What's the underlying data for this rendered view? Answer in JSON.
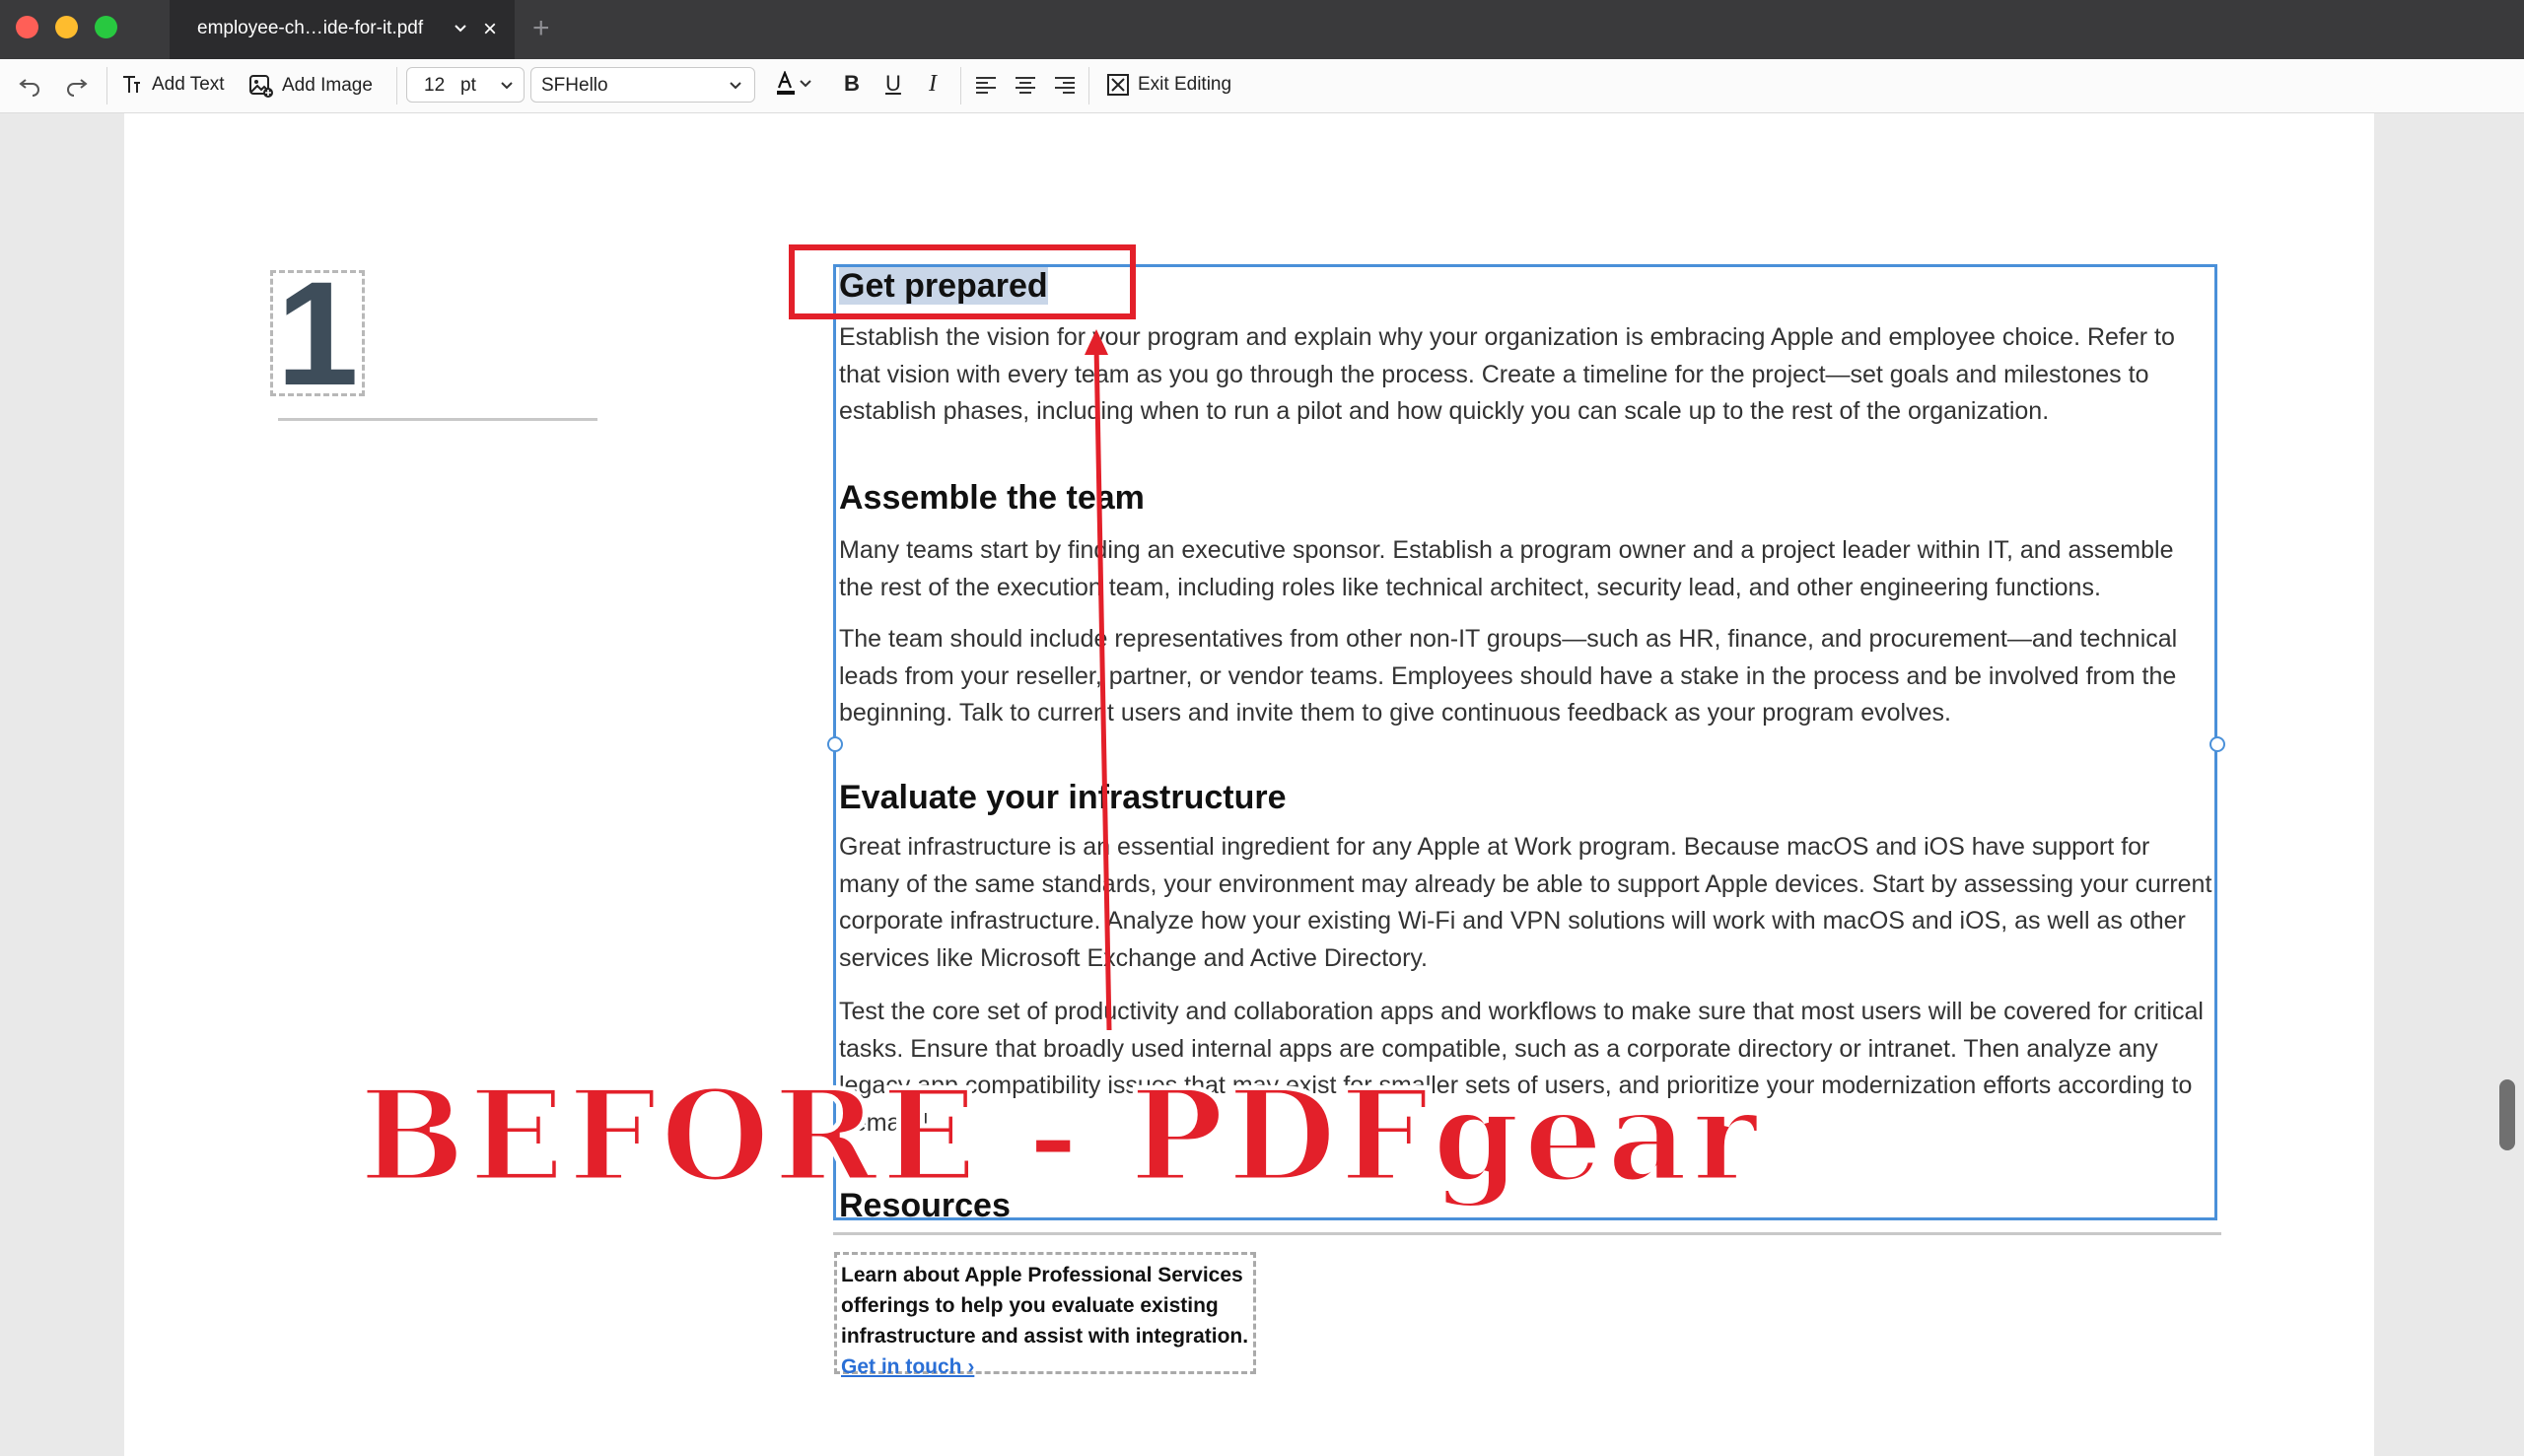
{
  "window": {
    "tab_title": "employee-ch…ide-for-it.pdf",
    "traffic_lights": {
      "close": "#ff5f57",
      "minimize": "#febc2e",
      "zoom": "#28c840"
    }
  },
  "toolbar": {
    "add_text": "Add Text",
    "add_image": "Add Image",
    "font_size": "12",
    "font_unit": "pt",
    "font_family": "SFHello",
    "exit_editing": "Exit Editing"
  },
  "page": {
    "section_number": "1",
    "h_get_prepared": "Get prepared",
    "p_get_prepared": "Establish the vision for your program and explain why your organization is embracing Apple and employee choice. Refer to that vision with every team as you go through the process. Create a timeline for the project—set goals and milestones to establish phases, including when to run a pilot and how quickly you can scale up to the rest of the organization.",
    "h_assemble": "Assemble the team",
    "p_assemble_1": "Many teams start by finding an executive sponsor. Establish a program owner and a project leader within IT, and assemble the rest of the execution team, including roles like technical architect, security lead, and other engineering functions.",
    "p_assemble_2": "The team should include representatives from other non-IT groups—such as HR, finance, and procurement—and technical leads from your reseller, partner, or vendor teams. Employees should have a stake in the process and be involved from the beginning. Talk to current users and invite them to give continuous feedback as your program evolves.",
    "h_evaluate": "Evaluate your infrastructure",
    "p_evaluate_1": "Great infrastructure is an essential ingredient for any Apple at Work program. Because macOS and iOS have support for many of the same standards, your environment may already be able to support Apple devices. Start by assessing your current corporate infrastructure. Analyze how your existing Wi-Fi and VPN solutions will work with macOS and iOS, as well as other services like Microsoft Exchange and Active Directory.",
    "p_evaluate_2": "Test the core set of productivity and collaboration apps and workflows to make sure that most users will be covered for critical tasks. Ensure that broadly used internal apps are compatible, such as a corporate directory or intranet. Then analyze any legacy app compatibility issues that may exist for smaller sets of users, and prioritize your modernization efforts according to demand.",
    "h_resources": "Resources",
    "resources_text": "Learn about Apple Professional Services offerings to help you evaluate existing infrastructure and assist with integration.",
    "resources_link": "Get in touch ›"
  },
  "overlay": {
    "banner": "BEFORE - PDFgear",
    "annotation_color": "#e3202a"
  }
}
